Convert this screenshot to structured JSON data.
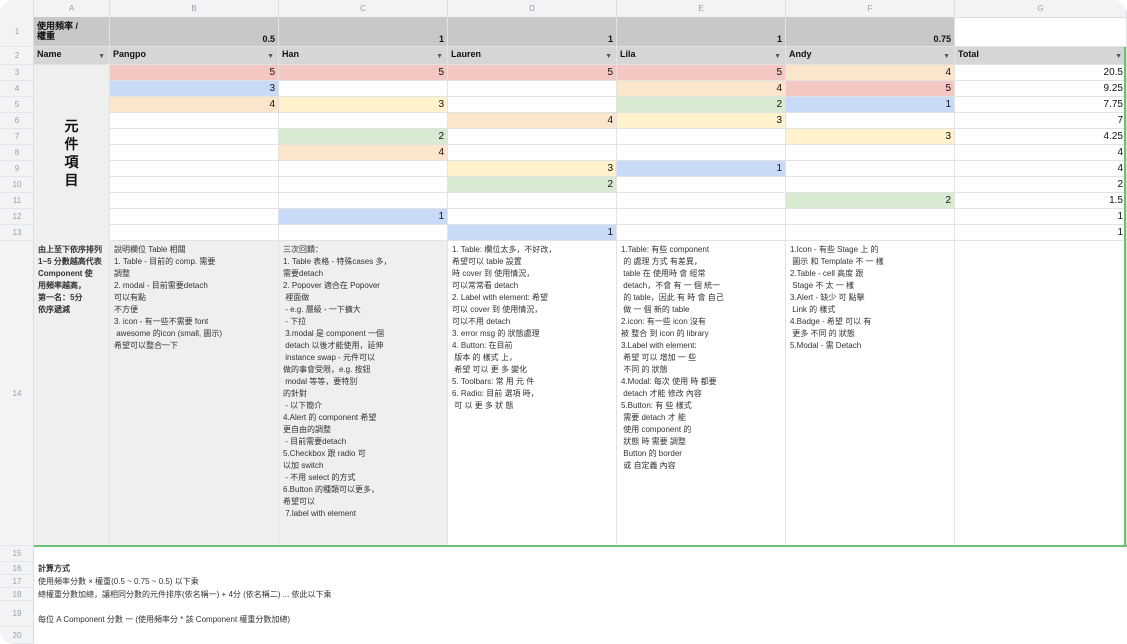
{
  "colors": {
    "red": "#f4c7c3",
    "blue": "#c9daf8",
    "orange": "#fce5cd",
    "yellow": "#fff2cc",
    "green": "#d9ead3",
    "selection": "#6fbf73"
  },
  "column_letters": [
    "A",
    "B",
    "C",
    "D",
    "E",
    "F",
    "G"
  ],
  "row_numbers": [
    "1",
    "2",
    "3",
    "4",
    "5",
    "6",
    "7",
    "8",
    "9",
    "10",
    "11",
    "12",
    "13",
    "14",
    "15",
    "16",
    "17",
    "18",
    "19",
    "20"
  ],
  "header": {
    "title_cell": "使用頻率 /\n權重",
    "weights": [
      "0.5",
      "1",
      "1",
      "1",
      "0.75"
    ],
    "names": [
      "Name",
      "Pangpo",
      "Han",
      "Lauren",
      "Lila",
      "Andy",
      "Total"
    ]
  },
  "category_label": [
    "元",
    "件",
    "項",
    "目"
  ],
  "rows": [
    {
      "cells": [
        [
          "5",
          "red"
        ],
        [
          "5",
          "red"
        ],
        [
          "5",
          "red"
        ],
        [
          "5",
          "red"
        ],
        [
          "4",
          "orange"
        ]
      ],
      "total": "20.5"
    },
    {
      "cells": [
        [
          "3",
          "blue"
        ],
        [
          "",
          ""
        ],
        [
          "",
          ""
        ],
        [
          "4",
          "orange"
        ],
        [
          "5",
          "red"
        ]
      ],
      "total": "9.25"
    },
    {
      "cells": [
        [
          "4",
          "orange"
        ],
        [
          "3",
          "yellow"
        ],
        [
          "",
          ""
        ],
        [
          "2",
          "green"
        ],
        [
          "1",
          "blue"
        ]
      ],
      "total": "7.75"
    },
    {
      "cells": [
        [
          "",
          ""
        ],
        [
          "",
          ""
        ],
        [
          "4",
          "orange"
        ],
        [
          "3",
          "yellow"
        ],
        [
          "",
          ""
        ]
      ],
      "total": "7"
    },
    {
      "cells": [
        [
          "",
          ""
        ],
        [
          "2",
          "green"
        ],
        [
          "",
          ""
        ],
        [
          "",
          ""
        ],
        [
          "3",
          "yellow"
        ]
      ],
      "total": "4.25"
    },
    {
      "cells": [
        [
          "",
          ""
        ],
        [
          "4",
          "orange"
        ],
        [
          "",
          ""
        ],
        [
          "",
          ""
        ],
        [
          "",
          ""
        ]
      ],
      "total": "4"
    },
    {
      "cells": [
        [
          "",
          ""
        ],
        [
          "",
          ""
        ],
        [
          "3",
          "yellow"
        ],
        [
          "1",
          "blue"
        ],
        [
          "",
          ""
        ]
      ],
      "total": "4"
    },
    {
      "cells": [
        [
          "",
          ""
        ],
        [
          "",
          ""
        ],
        [
          "2",
          "green"
        ],
        [
          "",
          ""
        ],
        [
          "",
          ""
        ]
      ],
      "total": "2"
    },
    {
      "cells": [
        [
          "",
          ""
        ],
        [
          "",
          ""
        ],
        [
          "",
          ""
        ],
        [
          "",
          ""
        ],
        [
          "2",
          "green"
        ]
      ],
      "total": "1.5"
    },
    {
      "cells": [
        [
          "",
          ""
        ],
        [
          "1",
          "blue"
        ],
        [
          "",
          ""
        ],
        [
          "",
          ""
        ],
        [
          "",
          ""
        ]
      ],
      "total": "1"
    },
    {
      "cells": [
        [
          "",
          ""
        ],
        [
          "",
          ""
        ],
        [
          "1",
          "blue"
        ],
        [
          "",
          ""
        ],
        [
          "",
          ""
        ]
      ],
      "total": "1"
    }
  ],
  "notes": {
    "a": "由上至下依序排列\n1~5 分數越高代表\nComponent 使\n用頻率越高，\n第一名：5分\n依序遞減",
    "b": "說明欄位 Table 相關\n1. Table - 目前的 comp. 需要\n調整\n2. modal - 目前需要detach\n可以有點\n不方便\n3. icon - 有一些不需要 font\n awesome 的icon (small, 圖示)\n希望可以整合一下",
    "c": "三次回饋：\n1. Table 表格 - 特殊cases 多，\n需要detach\n2. Popover 適合在 Popover\n 裡面做\n - e.g. 層級 - 一下擴大\n - 下拉\n 3.modal 是 component 一個\n detach 以後才能使用，延伸\n instance swap - 元件可以\n做的事會受限，e.g. 按鈕\n modal 等等，要特別\n的針對\n - 以下簡介\n4.Alert 的 component 希望\n更自由的調整\n - 目前需要detach\n5.Checkbox 跟 radio 可\n以加 switch\n - 不用 select 的方式\n6.Button 的種類可以更多，\n希望可以\n 7.label with element",
    "d": "1. Table: 欄位太多，不好改，\n希望可以 table 設置\n時 cover 到 使用情況，\n可以常常看 detach\n2. Label with element: 希望\n可以 cover 到 使用情況，\n可以不用 detach\n3. error msg 的 狀態處理\n4. Button: 在目前\n 版本 的 樣式 上，\n 希望 可以 更 多 變化\n5. Toolbars: 常 用 元 件\n6. Radio: 目前 選項 時，\n 可 以 更 多 狀 態",
    "e": "1.Table: 有些 component\n 的 處理 方式 有差異，\n table 在 使用時 會 經常\n detach，不會 有 一 個 統一\n 的 table，因此 有 時 會 自己\n 做 一 個 新的 table\n2.icon: 有一些 icon 沒有\n被 整合 到 icon 的 library\n3.Label with element:\n 希望 可以 增加 一 些\n 不同 的 狀態\n4.Modal: 每次 使用 時 都要\n detach 才能 修改 內容\n5.Button: 有 些 樣式\n 需要 detach 才 能\n 使用 component 的\n 狀態 時 需要 調整\n Button 的 border\n 或 自定義 內容",
    "f": "1.Icon - 有些 Stage 上 的\n 圖示 和 Template 不 一 樣\n2.Table - cell 高度 跟\n Stage 不 太 一 樣\n3.Alert - 缺少 可 點擊\n Link 的 樣式\n4.Badge - 希望 可以 有\n 更多 不同 的 狀態\n5.Modal - 需 Detach"
  },
  "footer": {
    "line1": "計算方式",
    "line2": "使用頻率分數 × 權重(0.5 ~ 0.75 ~ 0.5) 以下乘",
    "line3": "總權重分數加總，讓相同分數的元件排序(依名稱一) + 4分 (依名稱二) ... 依此以下乘",
    "line4": "每位 A Component 分數 一 (使用頻率分 * 該 Component 權重分數加總)"
  }
}
